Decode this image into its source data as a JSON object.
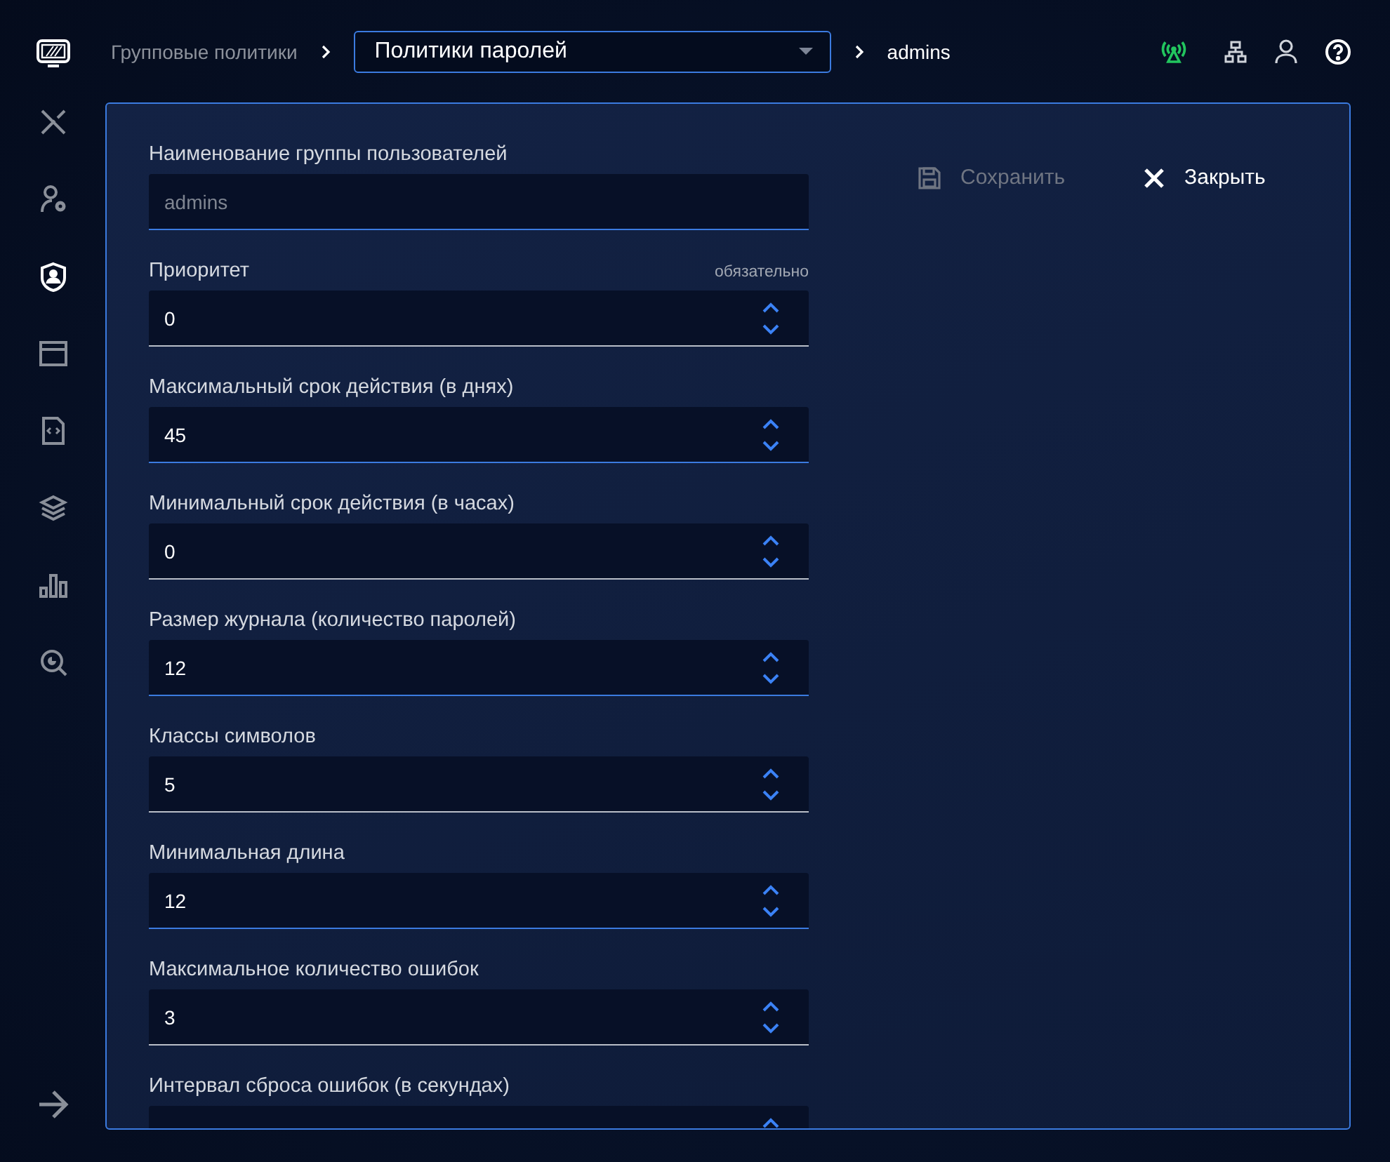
{
  "sidebar": {
    "items": [
      {
        "selected": false
      },
      {
        "selected": false
      },
      {
        "selected": true
      },
      {
        "selected": false
      },
      {
        "selected": false
      },
      {
        "selected": false
      },
      {
        "selected": false
      },
      {
        "selected": false
      }
    ]
  },
  "breadcrumb": {
    "root": "Групповые политики",
    "dropdown": "Политики паролей",
    "current": "admins"
  },
  "form": {
    "fields": [
      {
        "kind": "text",
        "label": "Наименование группы пользователей",
        "value": "admins",
        "disabled": true,
        "modified": true
      },
      {
        "kind": "number",
        "label": "Приоритет",
        "hint": "обязательно",
        "value": "0",
        "modified": false
      },
      {
        "kind": "number",
        "label": "Максимальный срок действия (в днях)",
        "value": "45",
        "modified": true
      },
      {
        "kind": "number",
        "label": "Минимальный срок действия (в часах)",
        "value": "0",
        "modified": false
      },
      {
        "kind": "number",
        "label": "Размер журнала (количество паролей)",
        "value": "12",
        "modified": true
      },
      {
        "kind": "number",
        "label": "Классы символов",
        "value": "5",
        "modified": false
      },
      {
        "kind": "number",
        "label": "Минимальная длина",
        "value": "12",
        "modified": true
      },
      {
        "kind": "number",
        "label": "Максимальное количество ошибок",
        "value": "3",
        "modified": false
      },
      {
        "kind": "number",
        "label": "Интервал сброса ошибок (в секундах)"
      }
    ]
  },
  "actions": {
    "save": {
      "label": "Сохранить",
      "disabled": true
    },
    "close": {
      "label": "Закрыть",
      "disabled": false
    }
  }
}
